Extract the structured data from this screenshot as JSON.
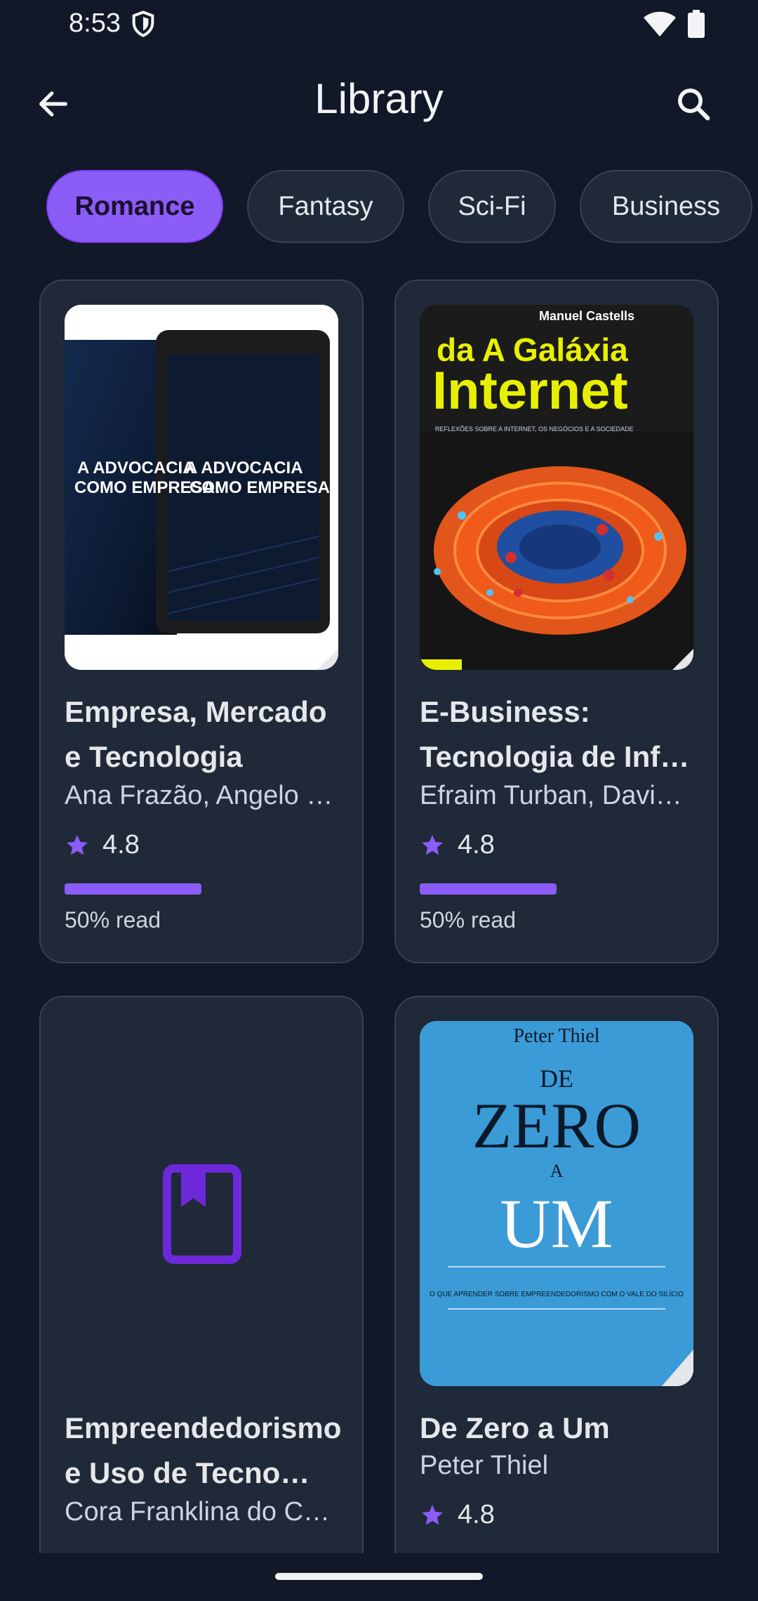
{
  "status_bar": {
    "time": "8:53"
  },
  "app_bar": {
    "title": "Library"
  },
  "chips": [
    {
      "label": "Romance",
      "selected": true
    },
    {
      "label": "Fantasy",
      "selected": false
    },
    {
      "label": "Sci-Fi",
      "selected": false
    },
    {
      "label": "Business",
      "selected": false
    }
  ],
  "books": [
    {
      "title": "Empresa, Mercado e Tecnologia",
      "authors": "Ana Frazão, Angelo …",
      "rating": "4.8",
      "progress_percent": 50,
      "read_label": "50% read",
      "cover": {
        "background": "#0f1b33",
        "lines": [
          "A ADVOCACIA",
          "COMO EMPRESA:"
        ]
      }
    },
    {
      "title": "E-Business: Tecnologia de Inf…",
      "authors": "Efraim Turban, Davi…",
      "rating": "4.8",
      "progress_percent": 50,
      "read_label": "50% read",
      "cover": {
        "author": "Manuel Castells",
        "line1": "da A Galáxia",
        "line2": "Internet",
        "subtitle": "REFLEXÕES SOBRE A INTERNET, OS NEGÓCIOS E A SOCIEDADE"
      }
    },
    {
      "title": "Empreendedorismo e Uso de Tecno…",
      "authors": "Cora Franklina do C…",
      "placeholder_icon": "book-bookmark-icon"
    },
    {
      "title": "De Zero a Um",
      "authors": "Peter Thiel",
      "rating": "4.8",
      "cover": {
        "author": "Peter Thiel",
        "w1": "DE",
        "w2": "ZERO",
        "w3": "A",
        "w4": "UM",
        "tagline": "O QUE APRENDER SOBRE EMPREENDEDORISMO COM O VALE DO SILÍCIO",
        "background": "#3b9bd6"
      }
    }
  ],
  "colors": {
    "background": "#111827",
    "card": "#1f2937",
    "accent": "#8b5cf6"
  }
}
